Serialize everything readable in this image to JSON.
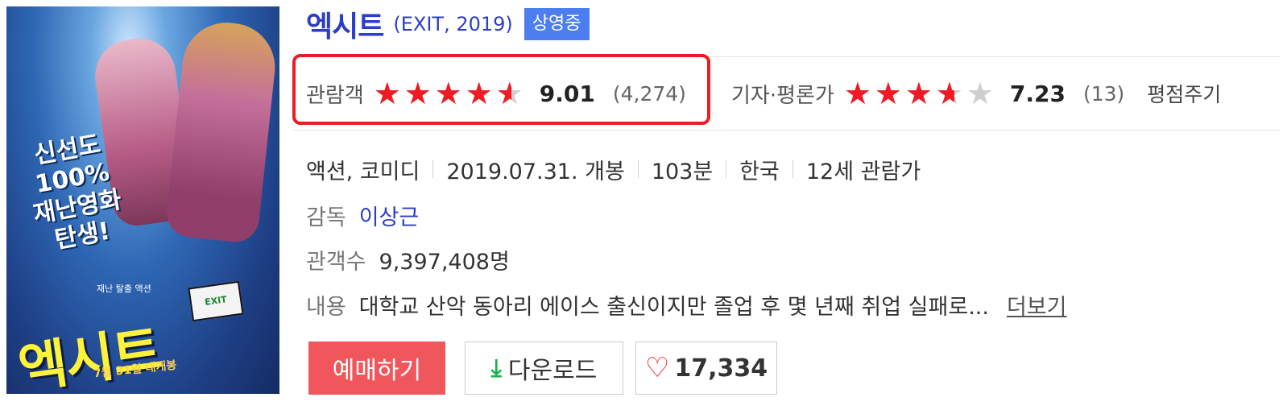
{
  "poster": {
    "tagline": [
      "신선도",
      "100%",
      "재난영화",
      "탄생!"
    ],
    "title_art": "엑시트",
    "small_text": "재난 탈출 액션",
    "exit_sign": "EXIT",
    "release_text": "7월 31일 대개봉"
  },
  "movie": {
    "title": "엑시트",
    "title_en": "(EXIT, 2019)",
    "status_badge": "상영중"
  },
  "ratings": {
    "audience": {
      "label": "관람객",
      "score": "9.01",
      "score_value": 9.01,
      "count": "(4,274)"
    },
    "critic": {
      "label": "기자·평론가",
      "score": "7.23",
      "score_value": 7.23,
      "count": "(13)"
    },
    "rate_link": "평점주기",
    "star_glyph": "★",
    "star_color": "#ef1a24"
  },
  "meta": {
    "genre": "액션, 코미디",
    "release": "2019.07.31. 개봉",
    "runtime": "103분",
    "country": "한국",
    "age": "12세 관람가"
  },
  "director": {
    "label": "감독",
    "name": "이상근"
  },
  "audience_count": {
    "label": "관객수",
    "value": "9,397,408명"
  },
  "plot": {
    "label": "내용",
    "text": "대학교 산악 동아리 에이스 출신이지만 졸업 후 몇 년째 취업 실패로...",
    "more": "더보기"
  },
  "buttons": {
    "reserve": "예매하기",
    "download": "다운로드",
    "likes": "17,334"
  },
  "icons": {
    "download": "download-arrow-icon",
    "like": "heart-icon"
  }
}
